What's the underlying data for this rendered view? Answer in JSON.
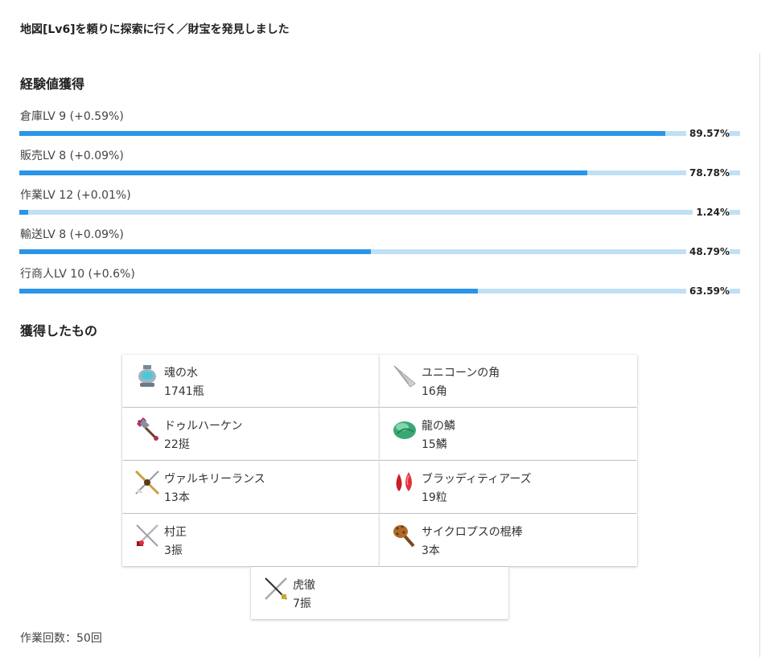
{
  "headline": "地図[Lv6]を頼りに探索に行く／財宝を発見しました",
  "exp_section": {
    "title": "経験値獲得",
    "rows": [
      {
        "label": "倉庫LV 9 (+0.59%)",
        "percent_text": "89.57%",
        "progress": 0.8957
      },
      {
        "label": "販売LV 8 (+0.09%)",
        "percent_text": "78.78%",
        "progress": 0.7878
      },
      {
        "label": "作業LV 12 (+0.01%)",
        "percent_text": "1.24%",
        "progress": 0.0124
      },
      {
        "label": "輸送LV 8 (+0.09%)",
        "percent_text": "48.79%",
        "progress": 0.4879
      },
      {
        "label": "行商人LV 10 (+0.6%)",
        "percent_text": "63.59%",
        "progress": 0.6359
      }
    ]
  },
  "items_section": {
    "title": "獲得したもの",
    "items": [
      {
        "name": "魂の水",
        "count": "1741瓶",
        "icon": "soul-water-icon"
      },
      {
        "name": "ユニコーンの角",
        "count": "16角",
        "icon": "unicorn-horn-icon"
      },
      {
        "name": "ドゥルハーケン",
        "count": "22挺",
        "icon": "durhaken-icon"
      },
      {
        "name": "龍の鱗",
        "count": "15鱗",
        "icon": "dragon-scale-icon"
      },
      {
        "name": "ヴァルキリーランス",
        "count": "13本",
        "icon": "valkyrie-lance-icon"
      },
      {
        "name": "ブラッディティアーズ",
        "count": "19粒",
        "icon": "bloody-tears-icon"
      },
      {
        "name": "村正",
        "count": "3振",
        "icon": "muramasa-icon"
      },
      {
        "name": "サイクロプスの棍棒",
        "count": "3本",
        "icon": "cyclops-club-icon"
      },
      {
        "name": "虎徹",
        "count": "7振",
        "icon": "kotetsu-icon"
      }
    ]
  },
  "work_count": "作業回数：50回",
  "colors": {
    "bar_fill": "#2a95e8",
    "bar_track": "#bfe0f5"
  }
}
